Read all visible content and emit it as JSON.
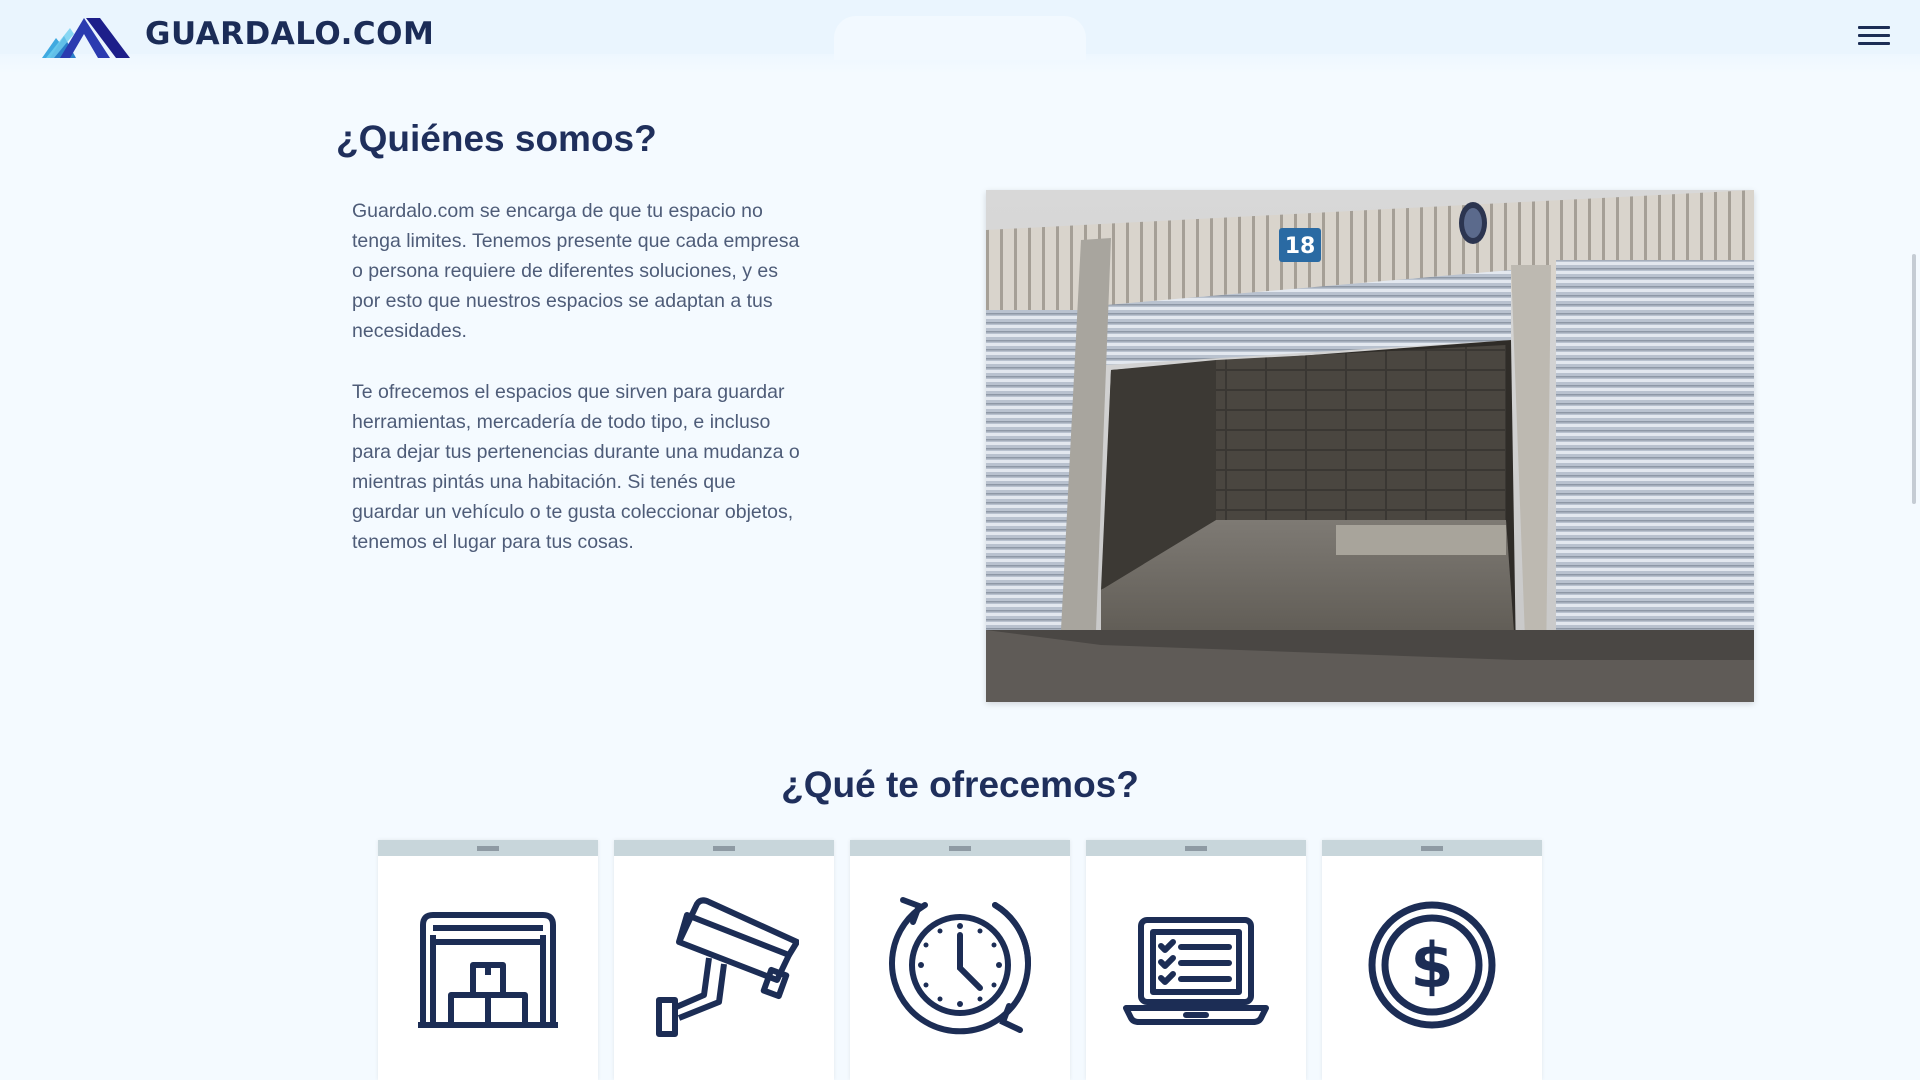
{
  "header": {
    "brand": "GUARDALO.COM",
    "tab_label": "Guardalo.com",
    "menu_icon": "hamburger-menu-icon"
  },
  "about": {
    "title": "¿Quiénes somos?",
    "paragraph_1": "Guardalo.com se encarga de que tu espacio no tenga limites. Tenemos presente que cada empresa o persona requiere de diferentes soluciones, y es por esto que nuestros espacios se adaptan a tus necesidades.",
    "paragraph_2": "Te ofrecemos el espacios que sirven para guardar herramientas, mercadería de todo tipo, e incluso para dejar tus pertenencias durante una mudanza o mientras pintás una habitación. Si tenés que guardar un vehículo o te gusta coleccionar objetos, tenemos el lugar para tus cosas.",
    "photo_unit_number": "18"
  },
  "offer": {
    "title": "¿Qué te ofrecemos?",
    "cards": [
      {
        "icon": "storage-unit-icon"
      },
      {
        "icon": "security-camera-icon"
      },
      {
        "icon": "clock-24h-icon"
      },
      {
        "icon": "laptop-checklist-icon"
      },
      {
        "icon": "dollar-coin-icon"
      }
    ]
  },
  "colors": {
    "navy": "#1c2d55",
    "background": "#f4faff",
    "card_header": "#c8d6db",
    "logo_blue": "#2b3bb0",
    "logo_cyan": "#3fa9e0"
  }
}
